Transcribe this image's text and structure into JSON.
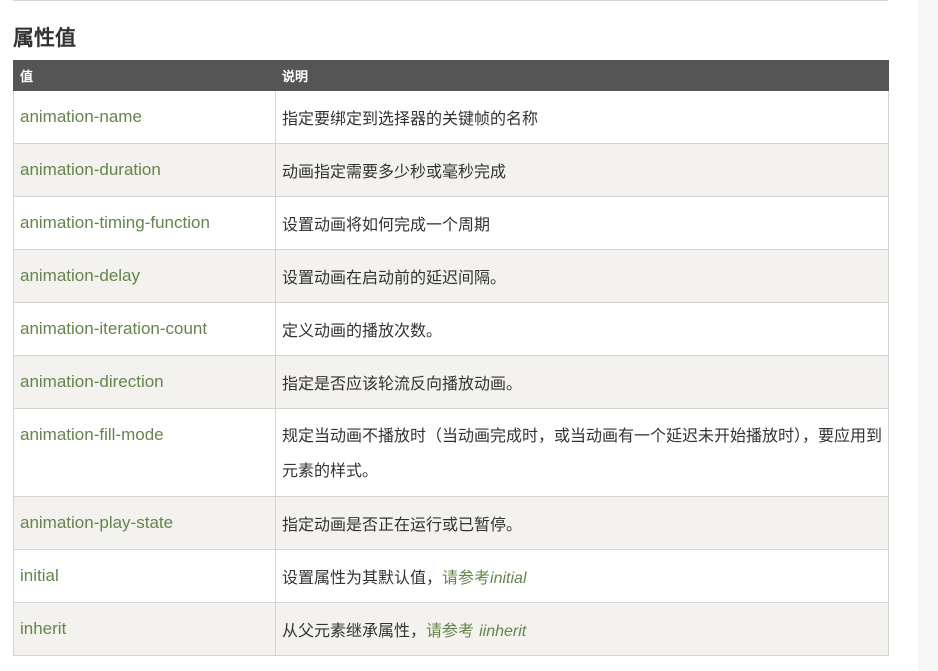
{
  "section": {
    "heading": "属性值"
  },
  "table": {
    "headers": {
      "value": "值",
      "description": "说明"
    },
    "rows": [
      {
        "value": "animation-name",
        "description": "指定要绑定到选择器的关键帧的名称"
      },
      {
        "value": "animation-duration",
        "description": "动画指定需要多少秒或毫秒完成"
      },
      {
        "value": "animation-timing-function",
        "description": "设置动画将如何完成一个周期"
      },
      {
        "value": "animation-delay",
        "description": "设置动画在启动前的延迟间隔。"
      },
      {
        "value": "animation-iteration-count",
        "description": "定义动画的播放次数。"
      },
      {
        "value": "animation-direction",
        "description": "指定是否应该轮流反向播放动画。"
      },
      {
        "value": "animation-fill-mode",
        "description": "规定当动画不播放时（当动画完成时，或当动画有一个延迟未开始播放时），要应用到元素的样式。"
      },
      {
        "value": "animation-play-state",
        "description": "指定动画是否正在运行或已暂停。"
      },
      {
        "value": "initial",
        "description": "设置属性为其默认值，",
        "link_text": "请参考",
        "link_italic": "initial"
      },
      {
        "value": "inherit",
        "description": "从父元素继承属性，",
        "link_text": "请参考 ",
        "link_italic": "iinherit"
      }
    ]
  },
  "colors": {
    "header_bg": "#555555",
    "value_text": "#64854c",
    "row_alt_bg": "#f3f2ee"
  }
}
